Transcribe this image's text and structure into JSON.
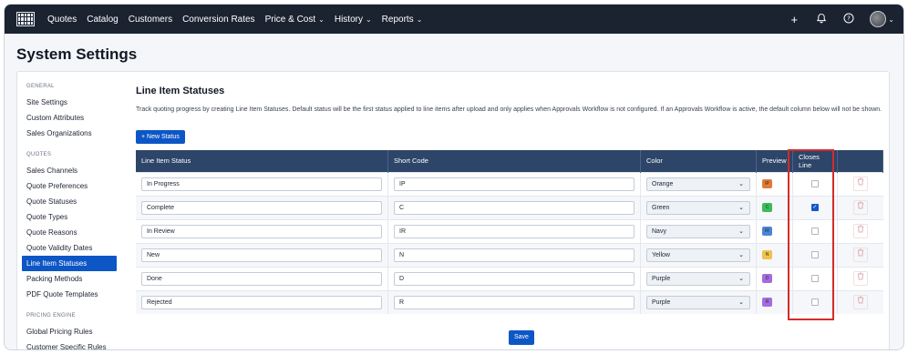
{
  "nav": {
    "items": [
      "Quotes",
      "Catalog",
      "Customers",
      "Conversion Rates",
      "Price & Cost",
      "History",
      "Reports"
    ],
    "dropdown_items": [
      false,
      false,
      false,
      false,
      true,
      true,
      true
    ],
    "right_icons": [
      "plus-icon",
      "bell-icon",
      "help-icon"
    ],
    "plus_glyph": "+",
    "bell_glyph": "🔔",
    "help_glyph": "?"
  },
  "page": {
    "title": "System Settings"
  },
  "sidebar": {
    "groups": [
      {
        "label": "GENERAL",
        "items": [
          "Site Settings",
          "Custom Attributes",
          "Sales Organizations"
        ]
      },
      {
        "label": "QUOTES",
        "items": [
          "Sales Channels",
          "Quote Preferences",
          "Quote Statuses",
          "Quote Types",
          "Quote Reasons",
          "Quote Validity Dates",
          "Line Item Statuses",
          "Packing Methods",
          "PDF Quote Templates"
        ]
      },
      {
        "label": "PRICING ENGINE",
        "items": [
          "Global Pricing Rules",
          "Customer Specific Rules"
        ]
      }
    ],
    "active": "Line Item Statuses"
  },
  "section": {
    "title": "Line Item Statuses",
    "description": "Track quoting progress by creating Line Item Statuses. Default status will be the first status applied to line items after upload and only applies when Approvals Workflow is not configured. If an Approvals Workflow is active, the default column below will not be shown.",
    "new_button": "+ New Status",
    "save_button": "Save"
  },
  "table": {
    "headers": [
      "Line Item Status",
      "Short Code",
      "Color",
      "Preview",
      "Closes Line",
      ""
    ],
    "rows": [
      {
        "status": "In Progress",
        "code": "IP",
        "color": "Orange",
        "chip_color": "#e07b39",
        "closes": false
      },
      {
        "status": "Complete",
        "code": "C",
        "color": "Green",
        "chip_color": "#3dbb5b",
        "closes": true
      },
      {
        "status": "In Review",
        "code": "IR",
        "color": "Navy",
        "chip_color": "#4a86d8",
        "closes": false
      },
      {
        "status": "New",
        "code": "N",
        "color": "Yellow",
        "chip_color": "#f2c14e",
        "closes": false
      },
      {
        "status": "Done",
        "code": "D",
        "color": "Purple",
        "chip_color": "#a46be0",
        "closes": false
      },
      {
        "status": "Rejected",
        "code": "R",
        "color": "Purple",
        "chip_color": "#a46be0",
        "closes": false
      }
    ]
  },
  "colors": {
    "nav_bg": "#1b2331",
    "accent": "#0d56c6",
    "table_header": "#2d4568",
    "highlight": "#d42b2b"
  }
}
